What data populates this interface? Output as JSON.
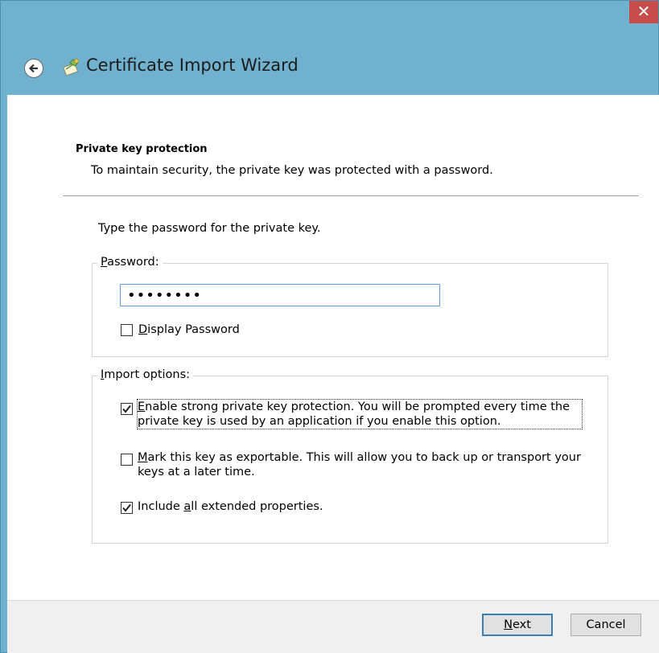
{
  "window": {
    "title": "Certificate Import Wizard",
    "close_glyph": "✕"
  },
  "page": {
    "heading": "Private key protection",
    "subheading": "To maintain security, the private key was protected with a password.",
    "instruction": "Type the password for the private key."
  },
  "password_group": {
    "legend_underlined": "P",
    "legend_rest": "assword:",
    "value": "••••••••",
    "display_password": {
      "underlined": "D",
      "rest": "isplay Password",
      "checked": false
    }
  },
  "import_options": {
    "legend_underlined": "I",
    "legend_rest": "mport options:",
    "options": [
      {
        "underlined": "E",
        "line1_rest": "nable strong private key protection. You will be prompted every time the",
        "line2": "private key is used by an application if you enable this option.",
        "checked": true
      },
      {
        "underlined": "M",
        "line1_rest": "ark this key as exportable. This will allow you to back up or transport your",
        "line2": "keys at a later time.",
        "checked": false
      },
      {
        "pre": "Include ",
        "underlined": "a",
        "rest": "ll extended properties.",
        "checked": true
      }
    ]
  },
  "footer": {
    "next_underlined": "N",
    "next_rest": "ext",
    "cancel_label": "Cancel"
  },
  "icons": {
    "back": "back-arrow-icon",
    "wizard": "certificate-wizard-icon",
    "close": "close-icon",
    "checkmark": "checkmark-icon"
  },
  "colors": {
    "title_bar": "#6fb1ce",
    "close_button": "#c74c4c",
    "input_border": "#5f9bd6",
    "default_button_border": "#3c7fb1"
  }
}
